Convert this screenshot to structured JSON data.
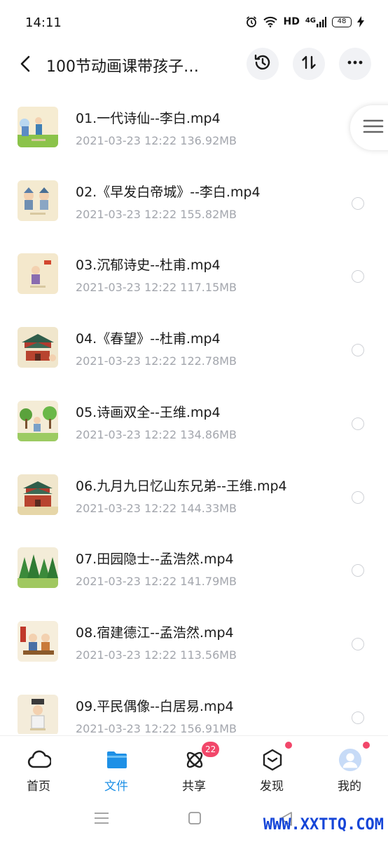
{
  "status_bar": {
    "time": "14:11",
    "hd": "HD",
    "network": "4G",
    "battery": "48"
  },
  "header": {
    "title": "100节动画课带孩子…",
    "icons": [
      "back-icon",
      "history-icon",
      "sort-icon",
      "more-icon"
    ]
  },
  "files": [
    {
      "name": "01.一代诗仙--李白.mp4",
      "meta": "2021-03-23  12:22   136.92MB"
    },
    {
      "name": "02.《早发白帝城》--李白.mp4",
      "meta": "2021-03-23  12:22   155.82MB"
    },
    {
      "name": "03.沉郁诗史--杜甫.mp4",
      "meta": "2021-03-23  12:22   117.15MB"
    },
    {
      "name": "04.《春望》--杜甫.mp4",
      "meta": "2021-03-23  12:22   122.78MB"
    },
    {
      "name": "05.诗画双全--王维.mp4",
      "meta": "2021-03-23  12:22   134.86MB"
    },
    {
      "name": "06.九月九日忆山东兄弟--王维.mp4",
      "meta": "2021-03-23  12:22   144.33MB"
    },
    {
      "name": "07.田园隐士--孟浩然.mp4",
      "meta": "2021-03-23  12:22   141.79MB"
    },
    {
      "name": "08.宿建德江--孟浩然.mp4",
      "meta": "2021-03-23  12:22   113.56MB"
    },
    {
      "name": "09.平民偶像--白居易.mp4",
      "meta": "2021-03-23  12:22   156.91MB"
    }
  ],
  "bottom_nav": {
    "items": [
      {
        "label": "首页",
        "icon": "cloud-home-icon"
      },
      {
        "label": "文件",
        "icon": "folder-icon"
      },
      {
        "label": "共享",
        "icon": "share-atom-icon",
        "badge": "22"
      },
      {
        "label": "发现",
        "icon": "discover-box-icon"
      },
      {
        "label": "我的",
        "icon": "avatar-icon"
      }
    ]
  },
  "watermark": "WWW.XXTTQ.COM",
  "colors": {
    "accent": "#1e90e6",
    "badge": "#f2476a",
    "meta_text": "#a3a6ad",
    "watermark": "#1545d8"
  }
}
